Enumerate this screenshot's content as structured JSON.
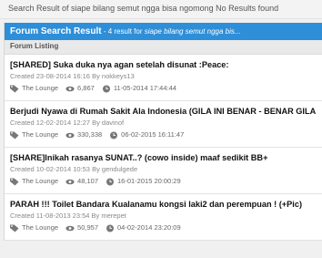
{
  "topbar": {
    "text": "Search Result of siape bilang semut ngga bisa ngomong No Results found"
  },
  "header": {
    "title": "Forum Search Result",
    "sub_prefix": " - 4 result for ",
    "query": "siape bilang semut ngga bis..."
  },
  "listing_label": "Forum Listing",
  "threads": [
    {
      "title": "[SHARED] Suka duka nya agan setelah disunat :Peace:",
      "created": "Created 23-08-2014 16:16 By nokkeys13",
      "forum": "The Lounge",
      "views": "6,867",
      "date": "11-05-2014 17:44:44"
    },
    {
      "title": "Berjudi Nyawa di Rumah Sakit Ala Indonesia (GILA INI BENAR - BENAR GILA!)",
      "created": "Created 12-02-2014 12:27 By davinof",
      "forum": "The Lounge",
      "views": "330,338",
      "date": "06-02-2015 16:11:47"
    },
    {
      "title": "[SHARE]Inikah rasanya SUNAT..? (cowo inside) maaf sedikit BB+",
      "created": "Created 10-02-2014 10:53 By gendulgede",
      "forum": "The Lounge",
      "views": "48,107",
      "date": "16-01-2015 20:00:29"
    },
    {
      "title": "PARAH !!! Toilet Bandara Kualanamu kongsi laki2 dan perempuan ! (+Pic)",
      "created": "Created 11-08-2013 23:54 By merepet",
      "forum": "The Lounge",
      "views": "50,957",
      "date": "04-02-2014 23:20:09"
    }
  ]
}
